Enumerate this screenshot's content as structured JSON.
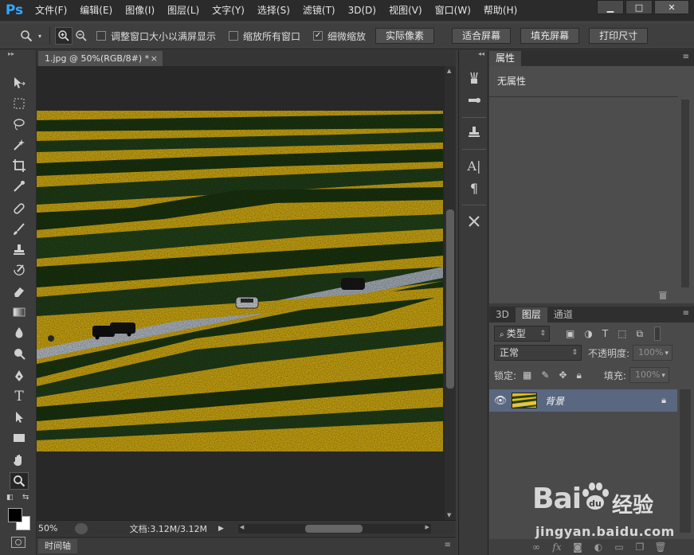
{
  "app": {
    "logo": "Ps",
    "menu": [
      "文件(F)",
      "编辑(E)",
      "图像(I)",
      "图层(L)",
      "文字(Y)",
      "选择(S)",
      "滤镜(T)",
      "3D(D)",
      "视图(V)",
      "窗口(W)",
      "帮助(H)"
    ],
    "window_controls": {
      "minimize": "▁",
      "maximize": "□",
      "close": "✕"
    }
  },
  "options_bar": {
    "tool_icon": "zoom-icon",
    "checkboxes": [
      {
        "label": "调整窗口大小以满屏显示",
        "checked": false
      },
      {
        "label": "缩放所有窗口",
        "checked": false
      },
      {
        "label": "细微缩放",
        "checked": true
      }
    ],
    "buttons": [
      "实际像素",
      "适合屏幕",
      "填充屏幕",
      "打印尺寸"
    ]
  },
  "document": {
    "tab_title": "1.jpg @ 50%(RGB/8#) *",
    "tab_close": "×",
    "zoom": "50%",
    "doc_info": "文档:3.12M/3.12M"
  },
  "timeline": {
    "label": "时间轴"
  },
  "properties": {
    "tab": "属性",
    "content": "无属性"
  },
  "layers": {
    "tabs": [
      "3D",
      "图层",
      "通道"
    ],
    "active_tab": "图层",
    "filter_kind": "类型",
    "blend_mode": "正常",
    "opacity_label": "不透明度:",
    "opacity_value": "100%",
    "lock_label": "锁定:",
    "fill_label": "填充:",
    "fill_value": "100%",
    "items": [
      {
        "name": "背景",
        "visible": true,
        "locked": true
      }
    ]
  },
  "watermark": {
    "logo_text_left": "Bai",
    "logo_text_right": "经验",
    "url": "jingyan.baidu.com"
  },
  "colors": {
    "ps_blue": "#31a8ff",
    "foreground": "#000000",
    "background": "#ffffff",
    "layer_selected": "#5a6780",
    "rapeseed_yellow": "#e8bd14",
    "field_green": "#1f3d12"
  }
}
